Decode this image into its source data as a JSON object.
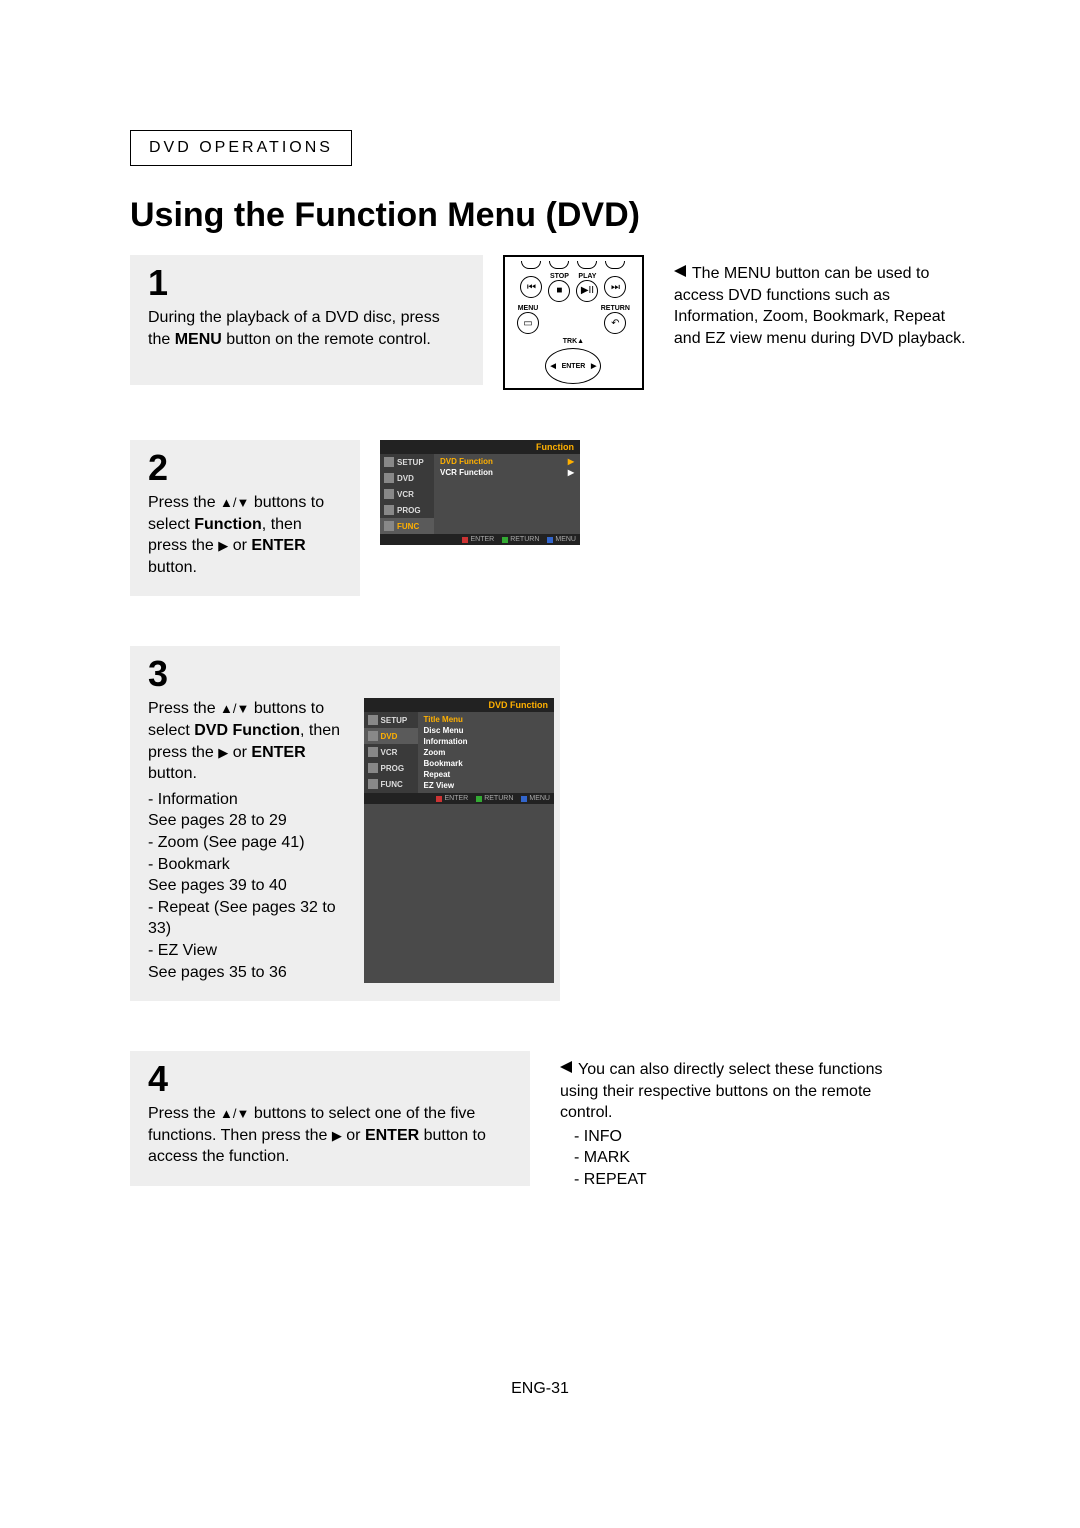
{
  "header": {
    "section": "DVD OPERATIONS"
  },
  "title": "Using the Function Menu (DVD)",
  "steps": {
    "s1": {
      "num": "1",
      "text_a": "During the playback of a DVD disc, press the ",
      "text_b_bold": "MENU",
      "text_c": " button on the remote control."
    },
    "s2": {
      "num": "2",
      "text_a": "Press the  ",
      "arrows": "▲/▼",
      "text_b": "  buttons to select ",
      "bold1": "Function",
      "text_c": ", then press the ",
      "arrow_right": "▶",
      "text_d": " or ",
      "bold2": "ENTER",
      "text_e": " button."
    },
    "s3": {
      "num": "3",
      "text_a": "Press the  ",
      "arrows": "▲/▼",
      "text_b": "  buttons to select ",
      "bold1": "DVD Function",
      "text_c": ", then press the ",
      "arrow_right": "▶",
      "text_d": " or ",
      "bold2": "ENTER",
      "text_e": " button.",
      "bullets": [
        "Information\nSee pages 28 to 29",
        "Zoom (See page 41)",
        "Bookmark\nSee pages 39 to 40",
        "Repeat (See pages 32 to 33)",
        "EZ View\nSee pages 35 to 36"
      ]
    },
    "s4": {
      "num": "4",
      "text_a": "Press the  ",
      "arrows": "▲/▼",
      "text_b": "  buttons to select one of the five functions. Then press the ",
      "arrow_right": "▶",
      "text_d": " or ",
      "bold2": "ENTER",
      "text_e": " button to access the function."
    }
  },
  "notes": {
    "n1": "The MENU button can be used to access DVD functions such as Information, Zoom, Bookmark, Repeat and EZ view menu during DVD playback.",
    "n4": "You can also directly select these functions using their respective buttons on the remote control.",
    "n4_list": [
      "INFO",
      "MARK",
      "REPEAT"
    ]
  },
  "remote": {
    "stop": "STOP",
    "play": "PLAY",
    "menu": "MENU",
    "return": "RETURN",
    "trk": "TRK▲",
    "enter": "ENTER"
  },
  "osd1": {
    "header": "Function",
    "tabs": [
      "SETUP",
      "DVD",
      "VCR",
      "PROG",
      "FUNC"
    ],
    "items": [
      "DVD Function",
      "VCR Function"
    ],
    "footer": [
      "ENTER",
      "RETURN",
      "MENU"
    ]
  },
  "osd2": {
    "header": "DVD Function",
    "tabs": [
      "SETUP",
      "DVD",
      "VCR",
      "PROG",
      "FUNC"
    ],
    "items": [
      "Title Menu",
      "Disc Menu",
      "Information",
      "Zoom",
      "Bookmark",
      "Repeat",
      "EZ View"
    ],
    "footer": [
      "ENTER",
      "RETURN",
      "MENU"
    ]
  },
  "footer": {
    "page": "ENG-31"
  }
}
